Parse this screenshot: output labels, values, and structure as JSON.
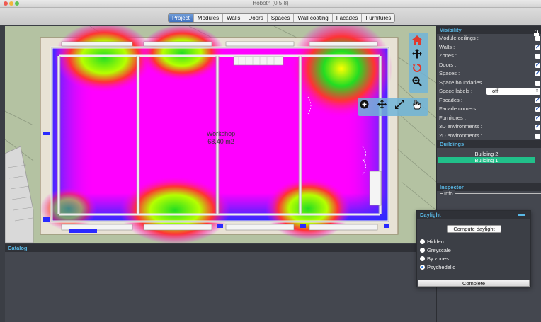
{
  "window": {
    "title": "Hoboth (0.5.8)"
  },
  "toolbar": {
    "tabs": [
      {
        "label": "Project"
      },
      {
        "label": "Modules"
      },
      {
        "label": "Walls"
      },
      {
        "label": "Doors"
      },
      {
        "label": "Spaces"
      },
      {
        "label": "Wall coating"
      },
      {
        "label": "Facades"
      },
      {
        "label": "Furnitures"
      }
    ],
    "active_tab": "Project"
  },
  "viewport": {
    "room_name": "Workshop",
    "room_area": "68,40 m2",
    "nav_icons": [
      "home-icon",
      "move-icon",
      "rotate-icon",
      "zoom-icon"
    ],
    "tool_icons": [
      "add-icon",
      "move-icon",
      "resize-icon",
      "hand-icon"
    ]
  },
  "visibility": {
    "title": "Visibility",
    "items": [
      {
        "label": "Module ceilings :",
        "checked": false
      },
      {
        "label": "Walls :",
        "checked": true
      },
      {
        "label": "Zones :",
        "checked": false
      },
      {
        "label": "Doors :",
        "checked": true
      },
      {
        "label": "Spaces :",
        "checked": true
      },
      {
        "label": "Space boundaries :",
        "checked": false
      },
      {
        "label": "Space labels :",
        "select": "off"
      },
      {
        "label": "Facades :",
        "checked": true
      },
      {
        "label": "Facade corners :",
        "checked": true
      },
      {
        "label": "Furnitures :",
        "checked": true
      },
      {
        "label": "3D environments :",
        "checked": true
      },
      {
        "label": "2D environments :",
        "checked": false
      }
    ]
  },
  "buildings": {
    "title": "Buildings",
    "items": [
      "Building 2",
      "Building 1"
    ],
    "selected": "Building 1"
  },
  "inspector": {
    "title": "Inspector",
    "info_label": "Info"
  },
  "catalog": {
    "title": "Catalog"
  },
  "daylight": {
    "title": "Daylight",
    "compute_label": "Compute daylight",
    "options": [
      "Hidden",
      "Greyscale",
      "By zones",
      "Psychedelic"
    ],
    "selected": "Psychedelic",
    "complete_label": "Complete"
  },
  "colors": {
    "accent": "#59b8e6",
    "selection": "#21c08a",
    "heat_high": "#ff00ff",
    "heat_low": "#4a2bff",
    "heat_peak": "#22dd22"
  }
}
